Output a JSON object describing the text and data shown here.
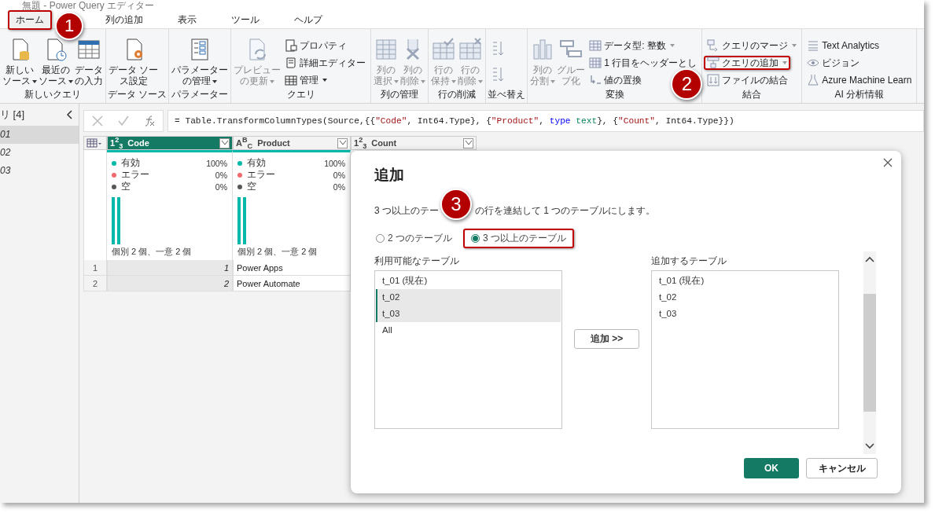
{
  "window": {
    "title": "無題 - Power Query エディター"
  },
  "tabs": [
    {
      "label": "ホーム",
      "selected": true,
      "highlighted": true,
      "badge": "1"
    },
    {
      "label": "列の追加",
      "selected": false
    },
    {
      "label": "表示",
      "selected": false
    },
    {
      "label": "ツール",
      "selected": false
    },
    {
      "label": "ヘルプ",
      "selected": false
    }
  ],
  "ribbon": [
    {
      "label": "新しいクエリ",
      "items": [
        {
          "kind": "large",
          "lines": [
            "新しい",
            "ソース"
          ],
          "dropdown": true,
          "disabled": false
        },
        {
          "kind": "large",
          "lines": [
            "最近の",
            "ソース"
          ],
          "dropdown": true,
          "disabled": false
        },
        {
          "kind": "large",
          "lines": [
            "データ",
            "の入力"
          ],
          "dropdown": false,
          "disabled": false
        }
      ]
    },
    {
      "label": "データ ソース",
      "items": [
        {
          "kind": "large",
          "lines": [
            "データ ソー",
            "ス設定"
          ],
          "dropdown": false,
          "disabled": false
        }
      ]
    },
    {
      "label": "パラメーター",
      "items": [
        {
          "kind": "large",
          "lines": [
            "パラメーター",
            "の管理"
          ],
          "dropdown": true,
          "disabled": false
        }
      ]
    },
    {
      "label": "クエリ",
      "items": [
        {
          "kind": "large",
          "lines": [
            "プレビュー",
            "の更新"
          ],
          "dropdown": true,
          "disabled": true
        },
        {
          "kind": "small",
          "label": "プロパティ",
          "dropdown": false,
          "disabled": false
        },
        {
          "kind": "small",
          "label": "詳細エディター",
          "dropdown": false,
          "disabled": false
        },
        {
          "kind": "small",
          "label": "管理",
          "dropdown": true,
          "disabled": false
        }
      ]
    },
    {
      "label": "列の管理",
      "items": [
        {
          "kind": "large",
          "lines": [
            "列の",
            "選択"
          ],
          "dropdown": true,
          "disabled": true
        },
        {
          "kind": "large",
          "lines": [
            "列の",
            "削除"
          ],
          "dropdown": true,
          "disabled": true
        }
      ]
    },
    {
      "label": "行の削減",
      "items": [
        {
          "kind": "large",
          "lines": [
            "行の",
            "保持"
          ],
          "dropdown": true,
          "disabled": true
        },
        {
          "kind": "large",
          "lines": [
            "行の",
            "削除"
          ],
          "dropdown": true,
          "disabled": true
        }
      ]
    },
    {
      "label": "並べ替え",
      "items": [
        {
          "kind": "icon",
          "disabled": true
        },
        {
          "kind": "icon",
          "disabled": true
        }
      ]
    },
    {
      "label": "変換",
      "items": [
        {
          "kind": "large",
          "lines": [
            "列の",
            "分割"
          ],
          "dropdown": true,
          "disabled": true
        },
        {
          "kind": "large",
          "lines": [
            "グルー",
            "プ化"
          ],
          "dropdown": false,
          "disabled": true
        },
        {
          "kind": "small",
          "label": "データ型: 整数",
          "dropdown": true,
          "disabled": true
        },
        {
          "kind": "small",
          "label": "1 行目をヘッダーとし",
          "dropdown": false,
          "disabled": true
        },
        {
          "kind": "small",
          "label": "値の置換",
          "dropdown": false,
          "disabled": true
        }
      ]
    },
    {
      "label": "結合",
      "items": [
        {
          "kind": "small",
          "label": "クエリのマージ",
          "dropdown": true,
          "disabled": true
        },
        {
          "kind": "small",
          "label": "クエリの追加",
          "dropdown": true,
          "disabled": true,
          "highlighted": true,
          "badge": "2"
        },
        {
          "kind": "small",
          "label": "ファイルの結合",
          "dropdown": false,
          "disabled": true
        }
      ]
    },
    {
      "label": "AI 分析情報",
      "items": [
        {
          "kind": "small",
          "label": "Text Analytics",
          "dropdown": false,
          "disabled": true
        },
        {
          "kind": "small",
          "label": "ビジョン",
          "dropdown": false,
          "disabled": true
        },
        {
          "kind": "small",
          "label": "Azure Machine Learn",
          "dropdown": false,
          "disabled": true
        }
      ]
    }
  ],
  "queries": {
    "title": "リ [4]",
    "items": [
      {
        "label": "01",
        "selected": true
      },
      {
        "label": "02",
        "selected": false
      },
      {
        "label": "03",
        "selected": false
      }
    ]
  },
  "formula": [
    {
      "text": "= Table.TransformColumnTypes(Source,{{",
      "kind": "plain"
    },
    {
      "text": "\"Code\"",
      "kind": "string"
    },
    {
      "text": ", Int64.Type}, {",
      "kind": "plain"
    },
    {
      "text": "\"Product\"",
      "kind": "string"
    },
    {
      "text": ", ",
      "kind": "plain"
    },
    {
      "text": "type",
      "kind": "keyword"
    },
    {
      "text": "text",
      "kind": "type"
    },
    {
      "text": "}, {",
      "kind": "plain"
    },
    {
      "text": "\"Count\"",
      "kind": "string"
    },
    {
      "text": ", Int64.Type}})",
      "kind": "plain"
    }
  ],
  "table": {
    "columns": [
      {
        "type": "1$^{2}$$_{3}$",
        "name": "Code",
        "selected": true,
        "stats": [
          {
            "label": "有効",
            "value": "100%",
            "color": "#01b8aa"
          },
          {
            "label": "エラー",
            "value": "0%",
            "color": "#f36a6a"
          },
          {
            "label": "空",
            "value": "0%",
            "color": "#555555"
          }
        ],
        "distinct": "個別 2 個、一意 2 個"
      },
      {
        "type": "A$^{B}$$_{C}$",
        "name": "Product",
        "selected": false,
        "stats": [
          {
            "label": "有効",
            "value": "100%",
            "color": "#01b8aa"
          },
          {
            "label": "エラー",
            "value": "0%",
            "color": "#f36a6a"
          },
          {
            "label": "空",
            "value": "0%",
            "color": "#555555"
          }
        ],
        "distinct": "個別 2 個、一意 2 個"
      },
      {
        "type": "1$^{2}$$_{3}$",
        "name": "Count",
        "selected": false
      }
    ],
    "rows": [
      {
        "num": "1",
        "cells": [
          "1",
          "Power Apps"
        ]
      },
      {
        "num": "2",
        "cells": [
          "2",
          "Power Automate"
        ]
      }
    ]
  },
  "dialog": {
    "title": "追加",
    "description": {
      "parts": [
        "3 つ以上のテー",
        "の行を連結して 1 つのテーブルにします。"
      ],
      "badge": "3"
    },
    "options": [
      {
        "label": "2 つのテーブル",
        "selected": false
      },
      {
        "label": "3 つ以上のテーブル",
        "selected": true,
        "highlighted": true
      }
    ],
    "available": {
      "label": "利用可能なテーブル",
      "items": [
        {
          "label": "t_01 (現在)",
          "selected": false
        },
        {
          "label": "t_02",
          "selected": true
        },
        {
          "label": "t_03",
          "selected": true
        },
        {
          "label": "All",
          "selected": false
        }
      ]
    },
    "add_button": "追加 >>",
    "target": {
      "label": "追加するテーブル",
      "items": [
        "t_01 (現在)",
        "t_02",
        "t_03"
      ]
    },
    "buttons": [
      {
        "label": "OK",
        "kind": "primary"
      },
      {
        "label": "キャンセル",
        "kind": "secondary"
      }
    ]
  }
}
